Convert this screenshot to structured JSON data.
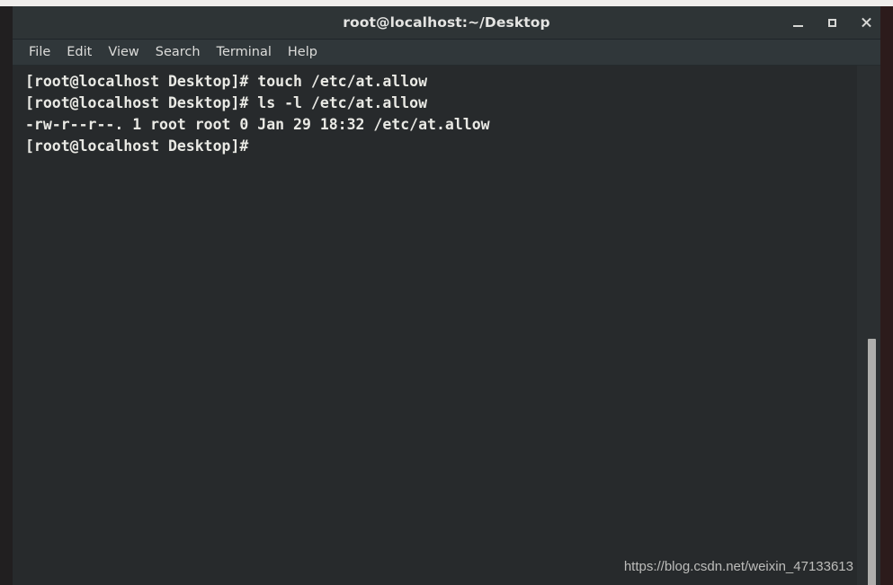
{
  "window": {
    "title": "root@localhost:~/Desktop",
    "controls": [
      {
        "name": "minimize-button",
        "label": "_"
      },
      {
        "name": "maximize-button",
        "label": "□"
      },
      {
        "name": "close-button",
        "label": "✕"
      }
    ]
  },
  "menu": {
    "items": [
      {
        "label": "File"
      },
      {
        "label": "Edit"
      },
      {
        "label": "View"
      },
      {
        "label": "Search"
      },
      {
        "label": "Terminal"
      },
      {
        "label": "Help"
      }
    ]
  },
  "terminal": {
    "prompt": "[root@localhost Desktop]#",
    "lines": [
      "[root@localhost Desktop]# touch /etc/at.allow",
      "[root@localhost Desktop]# ls -l /etc/at.allow",
      "-rw-r--r--. 1 root root 0 Jan 29 18:32 /etc/at.allow",
      "[root@localhost Desktop]#"
    ],
    "commands": [
      "touch /etc/at.allow",
      "ls -l /etc/at.allow"
    ],
    "file_listing": {
      "permissions": "-rw-r--r--.",
      "links": "1",
      "owner": "root",
      "group": "root",
      "size": "0",
      "month": "Jan",
      "day": "29",
      "time": "18:32",
      "path": "/etc/at.allow"
    }
  },
  "scrollbar": {
    "name": "vertical-scrollbar"
  },
  "watermark": {
    "text": "https://blog.csdn.net/weixin_47133613"
  },
  "colors": {
    "titlebar_bg": "#2e3436",
    "menubar_bg": "#30373a",
    "terminal_bg": "#272a2c",
    "terminal_fg": "#e9e9e4",
    "scrollbar_thumb": "#aeaeac",
    "border_right": "#2c1b1b",
    "border_left": "#211f20"
  }
}
